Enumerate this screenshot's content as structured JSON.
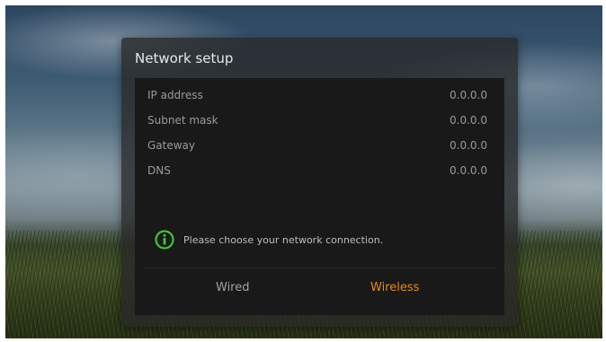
{
  "dialog": {
    "title": "Network setup"
  },
  "network_info": [
    {
      "label": "IP address",
      "value": "0.0.0.0"
    },
    {
      "label": "Subnet mask",
      "value": "0.0.0.0"
    },
    {
      "label": "Gateway",
      "value": "0.0.0.0"
    },
    {
      "label": "DNS",
      "value": "0.0.0.0"
    }
  ],
  "message": {
    "icon": "info-icon",
    "text": "Please choose your network connection."
  },
  "options": {
    "wired_label": "Wired",
    "wireless_label": "Wireless",
    "selected": "Wireless"
  },
  "colors": {
    "accent_selected": "#e58a1e",
    "info_icon_green": "#46c23a"
  }
}
